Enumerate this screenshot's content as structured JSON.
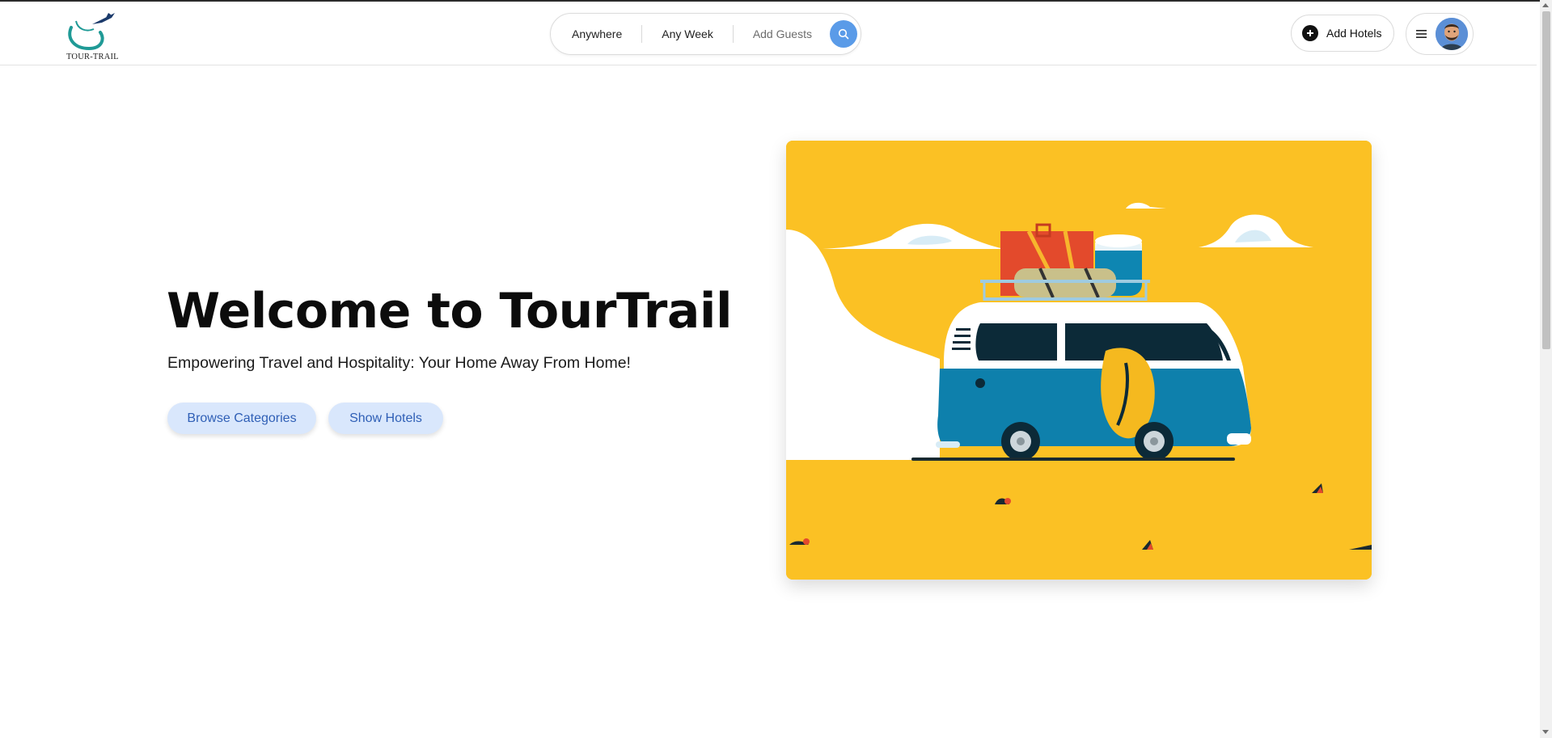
{
  "app": {
    "logo_text": "TOUR-TRAIL",
    "brand_colors": {
      "teal": "#1f9a96",
      "accent_blue": "#5a9be8",
      "hero_yellow": "#fbc124"
    }
  },
  "search": {
    "location_label": "Anywhere",
    "date_label": "Any Week",
    "guests_label": "Add Guests",
    "search_icon": "search-icon"
  },
  "header": {
    "add_hotels_label": "Add Hotels",
    "add_icon": "plus-circle-icon",
    "menu_icon": "hamburger-icon",
    "avatar_icon": "user-avatar"
  },
  "hero": {
    "title": "Welcome to TourTrail",
    "subtitle": "Empowering Travel and Hospitality: Your Home Away From Home!",
    "browse_button": "Browse Categories",
    "show_hotels_button": "Show Hotels",
    "illustration": "camper-van-illustration"
  }
}
